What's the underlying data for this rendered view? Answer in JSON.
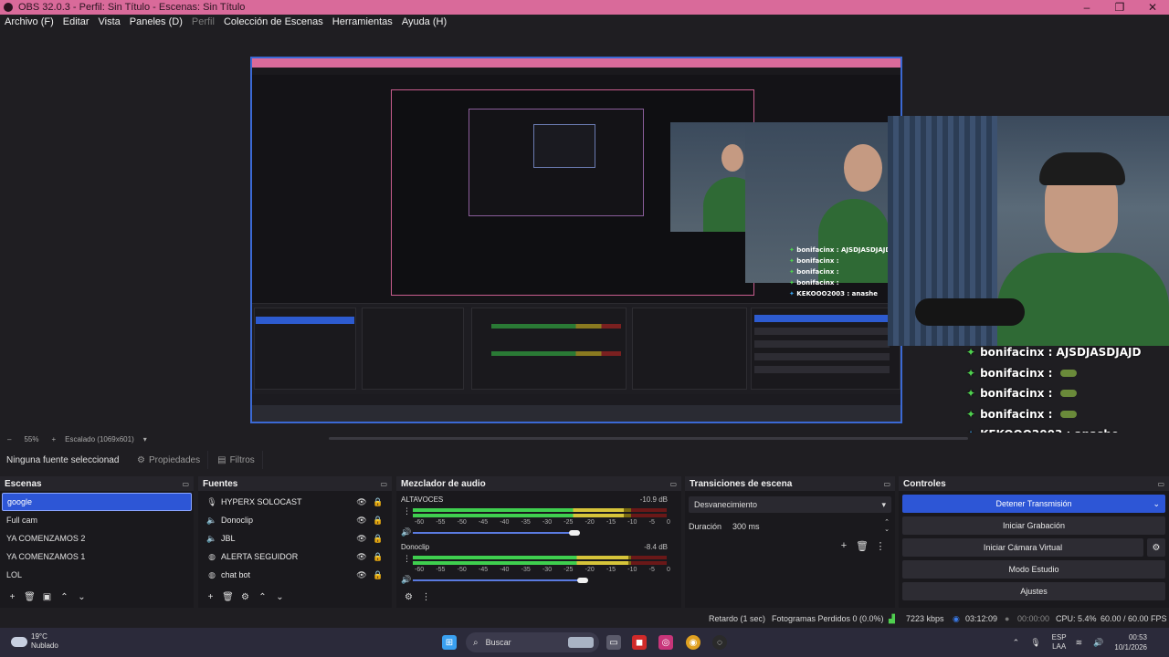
{
  "window": {
    "title": "OBS 32.0.3 - Perfil: Sin Título - Escenas: Sin Título",
    "controls": [
      "–",
      "❐",
      "✕"
    ]
  },
  "menu": [
    {
      "label": "Archivo (F)",
      "disabled": false
    },
    {
      "label": "Editar",
      "disabled": false
    },
    {
      "label": "Vista",
      "disabled": false
    },
    {
      "label": "Paneles (D)",
      "disabled": false
    },
    {
      "label": "Perfil",
      "disabled": true
    },
    {
      "label": "Colección de Escenas",
      "disabled": false
    },
    {
      "label": "Herramientas",
      "disabled": false
    },
    {
      "label": "Ayuda (H)",
      "disabled": false
    }
  ],
  "preview": {
    "chat": [
      {
        "user": "bonifacinx",
        "message": "AJSDJASDJAJD",
        "badge": "green",
        "emote": false
      },
      {
        "user": "bonifacinx",
        "message": "",
        "badge": "green",
        "emote": true
      },
      {
        "user": "bonifacinx",
        "message": "",
        "badge": "green",
        "emote": true
      },
      {
        "user": "bonifacinx",
        "message": "",
        "badge": "green",
        "emote": true
      },
      {
        "user": "KEKOOO2003",
        "message": "anashe",
        "badge": "blue",
        "emote": false
      }
    ],
    "separator": " : "
  },
  "zoom": {
    "value": "55%",
    "add": "+",
    "scale": "Escalado (1069x601)",
    "dropdown": "▾",
    "minus": "–"
  },
  "source_toolbar": {
    "none_label": "Ninguna fuente seleccionad",
    "properties": "Propiedades",
    "filters": "Filtros"
  },
  "scenes": {
    "title": "Escenas",
    "items": [
      "google",
      "Full cam",
      "YA COMENZAMOS 2",
      "YA COMENZAMOS 1",
      "LOL"
    ],
    "selected_index": 0
  },
  "sources": {
    "title": "Fuentes",
    "items": [
      {
        "name": "HYPERX SOLOCAST",
        "icon": "microphone-icon"
      },
      {
        "name": "Donoclip",
        "icon": "speaker-icon"
      },
      {
        "name": "JBL",
        "icon": "speaker-icon"
      },
      {
        "name": "ALERTA SEGUIDOR",
        "icon": "globe-icon"
      },
      {
        "name": "chat bot",
        "icon": "globe-icon"
      }
    ]
  },
  "mixer": {
    "title": "Mezclador de audio",
    "ticks": [
      "-60",
      "-55",
      "-50",
      "-45",
      "-40",
      "-35",
      "-30",
      "-25",
      "-20",
      "-15",
      "-10",
      "-5",
      "0"
    ],
    "channels": [
      {
        "name": "ALTAVOCES",
        "db": "-10.9 dB",
        "level": 0.83,
        "volume": 0.95
      },
      {
        "name": "Donoclip",
        "db": "-8.4 dB",
        "level": 0.85,
        "volume": 1.0
      }
    ]
  },
  "transitions": {
    "title": "Transiciones de escena",
    "selected": "Desvanecimiento",
    "duration_label": "Duración",
    "duration_value": "300 ms"
  },
  "controls": {
    "title": "Controles",
    "stream": "Detener Transmisión",
    "record": "Iniciar Grabación",
    "virtualcam": "Iniciar Cámara Virtual",
    "studio": "Modo Estudio",
    "settings": "Ajustes"
  },
  "status": {
    "delay": "Retardo (1 sec)",
    "dropped": "Fotogramas Perdidos 0 (0.0%)",
    "bitrate": "7223 kbps",
    "stream_time": "03:12:09",
    "rec_time": "00:00:00",
    "cpu": "CPU: 5.4%",
    "fps": "60.00 / 60.00 FPS"
  },
  "taskbar": {
    "temp": "19°C",
    "weather": "Nublado",
    "search": "Buscar",
    "lang1": "ESP",
    "lang2": "LAA",
    "time": "00:53",
    "date": "10/1/2026"
  }
}
